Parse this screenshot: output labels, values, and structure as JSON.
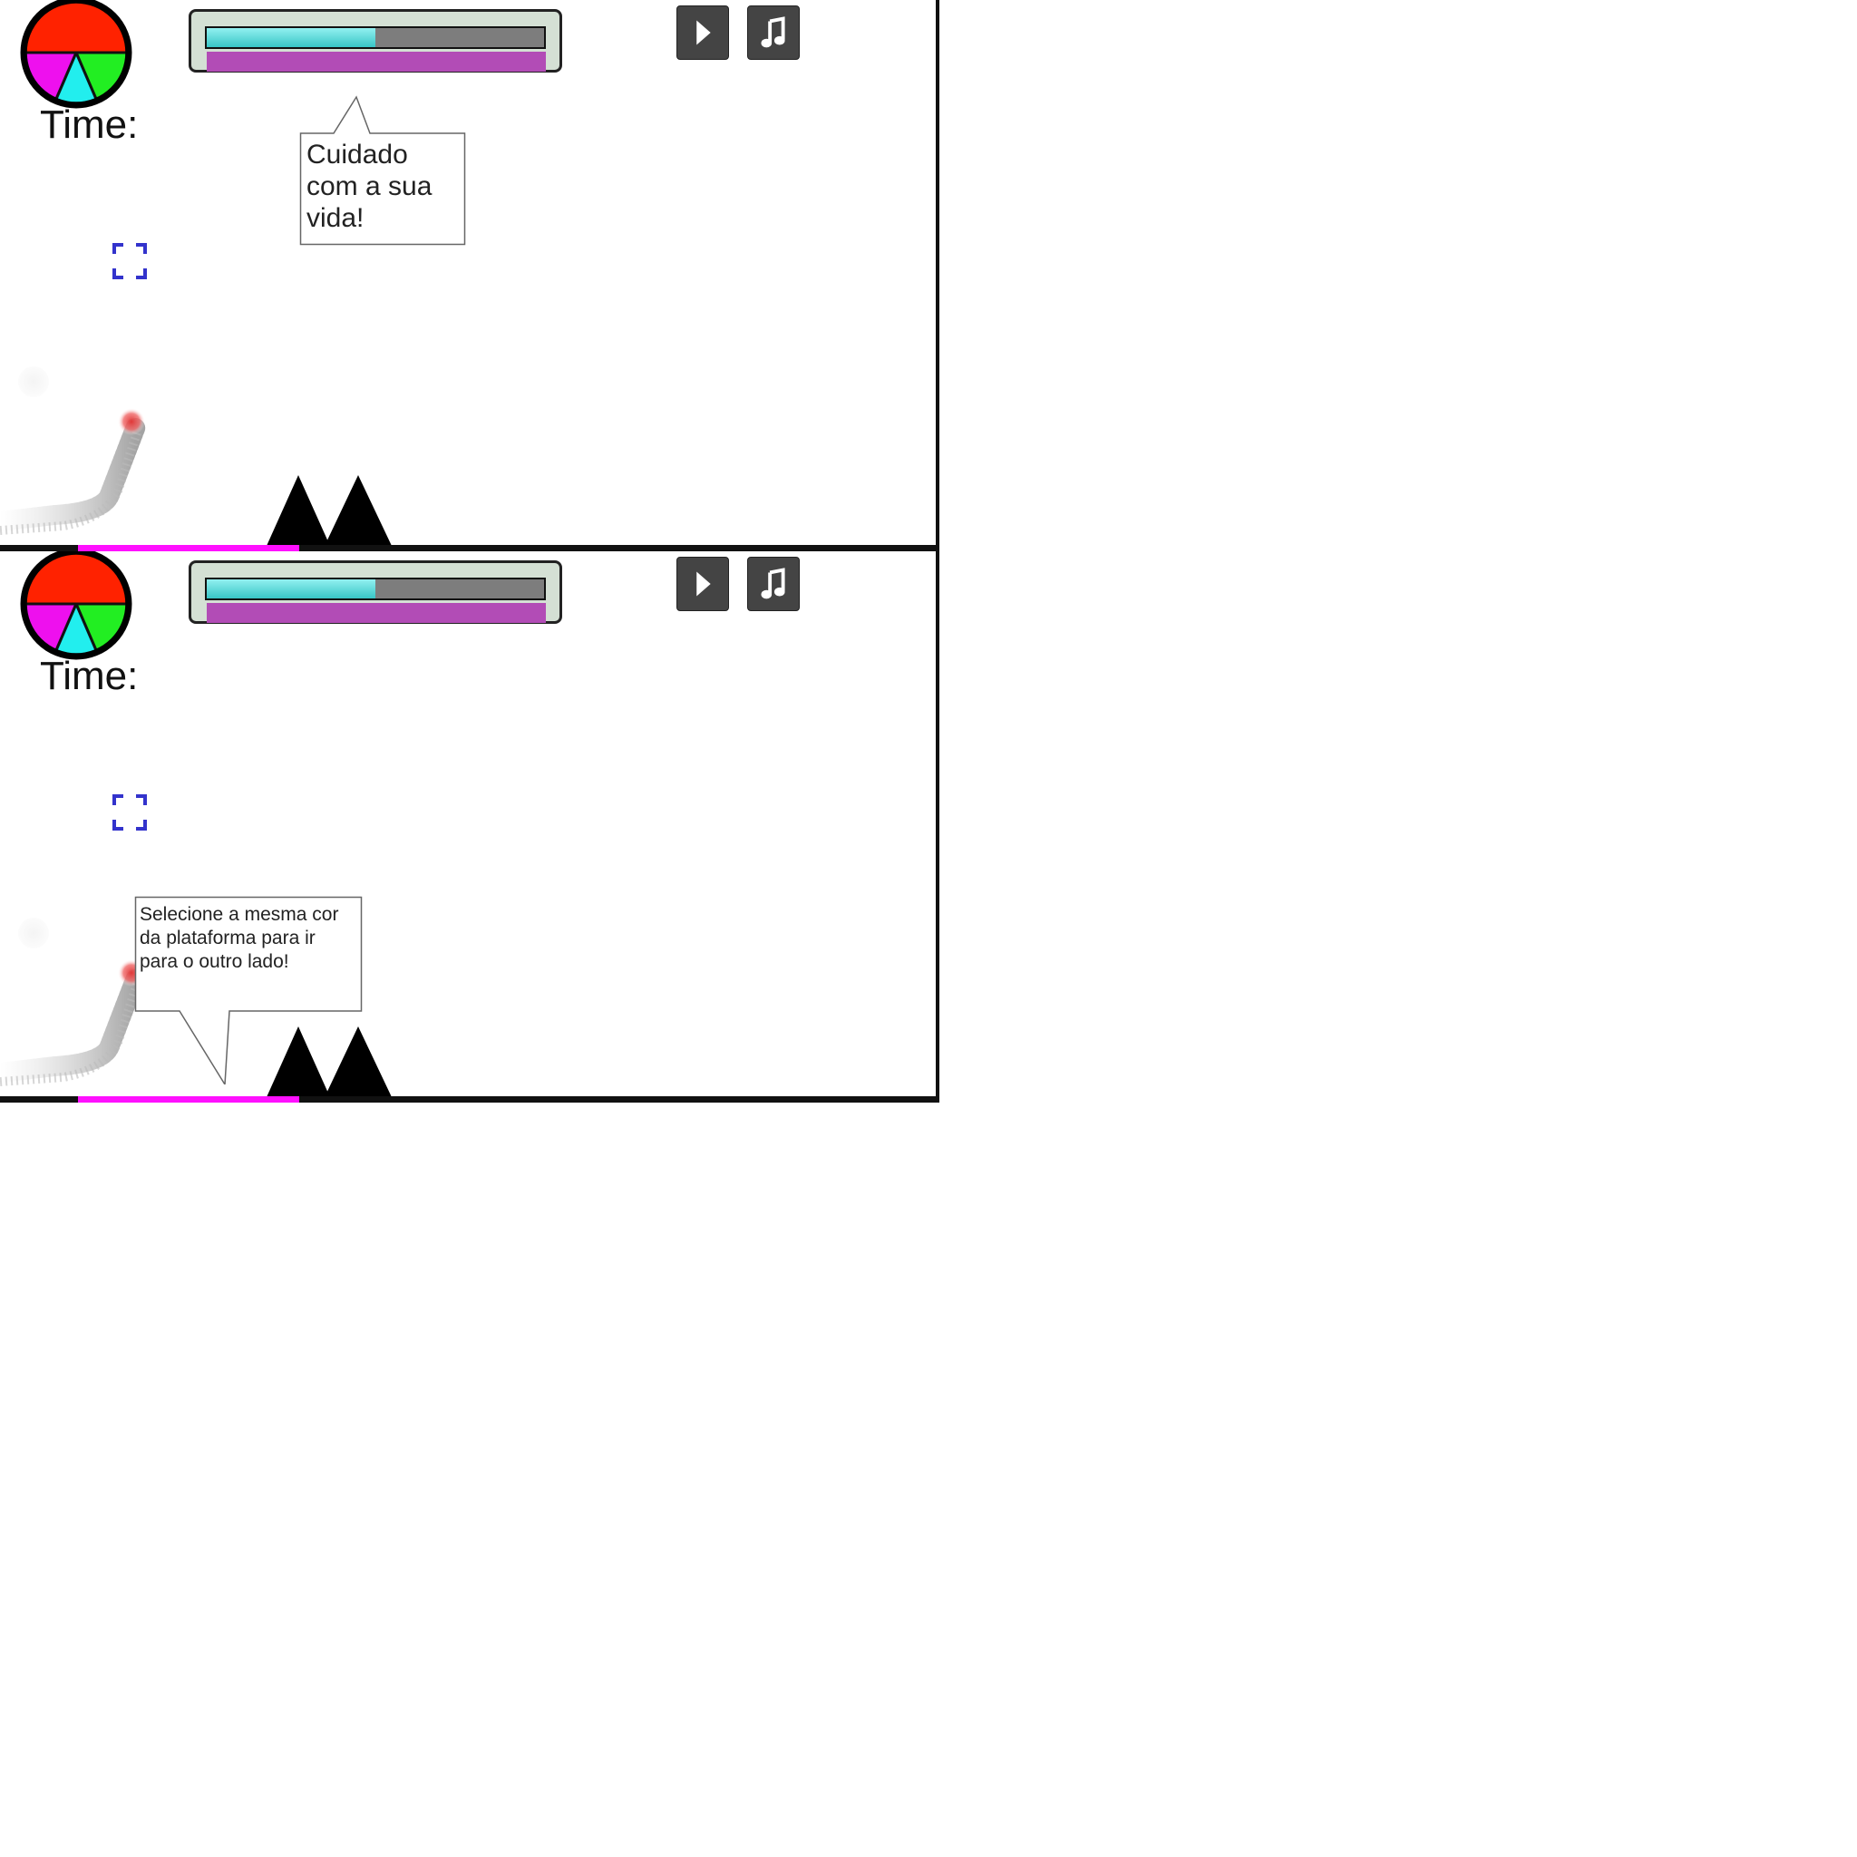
{
  "panels": [
    {
      "time_label": "Time:",
      "energy_fraction": 0.5,
      "life_fraction": 1.0,
      "hint": {
        "text_lines": [
          "Cuidado",
          "com a sua",
          "vida!"
        ]
      }
    },
    {
      "time_label": "Time:",
      "energy_fraction": 0.5,
      "life_fraction": 1.0,
      "hint": {
        "text_lines": [
          "Selecione a mesma cor",
          "da plataforma para ir",
          "para o outro lado!"
        ]
      }
    }
  ],
  "colors": {
    "wheel_top": "#ff2200",
    "wheel_left": "#ee10ee",
    "wheel_middle": "#22eeee",
    "wheel_right": "#22ee22",
    "platform_highlight": "#ff10ff",
    "energy": "#38c6c6",
    "life": "#b24cb6",
    "spike": "#000000",
    "player": "#e03838",
    "fullscreen_icon": "#3333cc"
  },
  "icons": {
    "play": "play-icon",
    "music": "music-note-icon",
    "fullscreen": "fullscreen-icon",
    "color_wheel": "color-wheel-icon"
  }
}
